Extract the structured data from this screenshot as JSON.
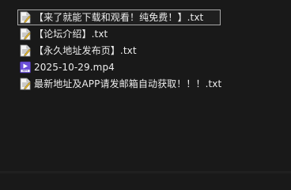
{
  "files": [
    {
      "name": "【来了就能下载和观看！纯免费！】.txt",
      "icon": "text-file-icon",
      "selected": true
    },
    {
      "name": "【论坛介绍】.txt",
      "icon": "text-file-icon",
      "selected": false
    },
    {
      "name": "【永久地址发布页】.txt",
      "icon": "text-file-icon",
      "selected": false
    },
    {
      "name": "2025-10-29.mp4",
      "icon": "video-file-icon",
      "selected": false
    },
    {
      "name": "最新地址及APP请发邮箱自动获取！！！.txt",
      "icon": "text-file-icon",
      "selected": false
    }
  ],
  "colors": {
    "background": "#191919",
    "text": "#ececec",
    "selection_border": "#a7a7a7",
    "video_icon": "#6b4fd8"
  }
}
